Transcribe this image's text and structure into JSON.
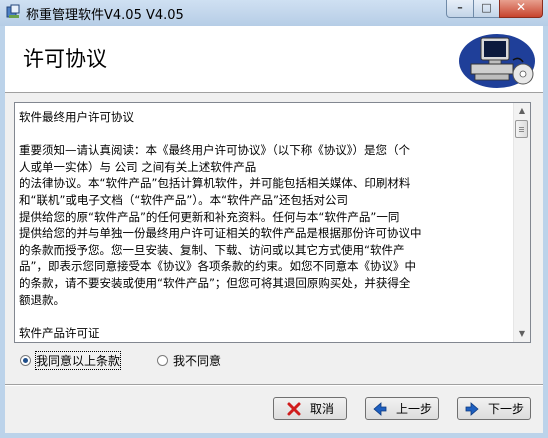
{
  "window": {
    "title": "称重管理软件V4.05 V4.05",
    "minimize_glyph": "–",
    "maximize_glyph": "□",
    "close_glyph": "✕"
  },
  "header": {
    "title": "许可协议",
    "art_icon": "computer-cd-icon"
  },
  "license": {
    "text": "软件最终用户许可协议\n\n重要须知—请认真阅读：本《最终用户许可协议》（以下称《协议》）是您（个\n人或单一实体）与 公司 之间有关上述软件产品\n的法律协议。本“软件产品”包括计算机软件，并可能包括相关媒体、印刷材料\n和“联机”或电子文档（“软件产品”）。本“软件产品”还包括对公司\n提供给您的原“软件产品”的任何更新和补充资料。任何与本“软件产品”一同\n提供给您的并与单独一份最终用户许可证相关的软件产品是根据那份许可协议中\n的条款而授予您。您一旦安装、复制、下载、访问或以其它方式使用“软件产\n品”，即表示您同意接受本《协议》各项条款的约束。如您不同意本《协议》中\n的条款，请不要安装或使用“软件产品”；但您可将其退回原购买处，并获得全\n额退款。\n\n软件产品许可证"
  },
  "options": {
    "agree_label": "我同意以上条款",
    "disagree_label": "我不同意",
    "selected": "agree"
  },
  "buttons": {
    "cancel_label": "取消",
    "prev_label": "上一步",
    "next_label": "下一步"
  },
  "colors": {
    "cancel_icon": "#d01c1c",
    "nav_icon": "#1e5fbf"
  }
}
